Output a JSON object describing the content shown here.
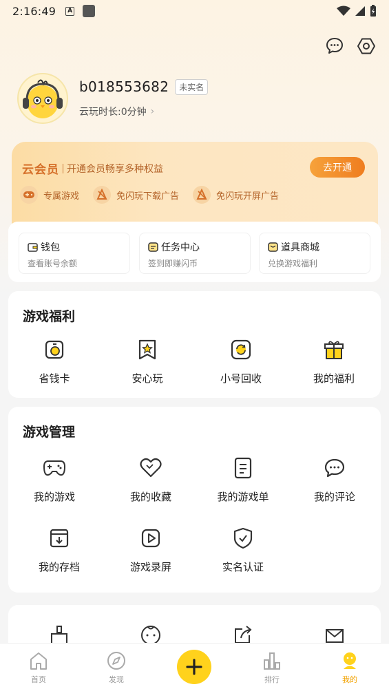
{
  "status_bar": {
    "time": "2:16:49",
    "a_glyph": "A"
  },
  "header": {
    "message_icon": "message-icon",
    "settings_icon": "settings-hex-icon"
  },
  "profile": {
    "username": "b018553682",
    "badge": "未实名",
    "playtime": "云玩时长:0分钟",
    "avatar_icon": "chick-headphones-avatar"
  },
  "vip": {
    "title": "云会员",
    "desc": "开通会员畅享多种权益",
    "button": "去开通",
    "perks": [
      {
        "label": "专属游戏",
        "icon": "gamepad-icon"
      },
      {
        "label": "免闪玩下载广告",
        "icon": "no-ad-icon"
      },
      {
        "label": "免闪玩开屏广告",
        "icon": "no-ad-icon"
      }
    ],
    "colors": {
      "accent": "#ef7d1f",
      "text": "#b4642a"
    }
  },
  "wallet": {
    "items": [
      {
        "title": "钱包",
        "sub": "查看账号余额"
      },
      {
        "title": "任务中心",
        "sub": "签到即赚闪币"
      },
      {
        "title": "道具商城",
        "sub": "兑换游戏福利"
      }
    ]
  },
  "benefits": {
    "title": "游戏福利",
    "items": [
      {
        "label": "省钱卡",
        "icon": "saving-card-icon"
      },
      {
        "label": "安心玩",
        "icon": "star-bookmark-icon"
      },
      {
        "label": "小号回收",
        "icon": "recycle-icon"
      },
      {
        "label": "我的福利",
        "icon": "gift-icon"
      }
    ]
  },
  "management": {
    "title": "游戏管理",
    "items": [
      {
        "label": "我的游戏",
        "icon": "gamepad-icon"
      },
      {
        "label": "我的收藏",
        "icon": "heart-icon"
      },
      {
        "label": "我的游戏单",
        "icon": "list-icon"
      },
      {
        "label": "我的评论",
        "icon": "comment-icon"
      },
      {
        "label": "我的存档",
        "icon": "archive-icon"
      },
      {
        "label": "游戏录屏",
        "icon": "play-icon"
      },
      {
        "label": "实名认证",
        "icon": "shield-check-icon"
      }
    ]
  },
  "more": {
    "icons": [
      "brush-icon",
      "baby-face-icon",
      "share-icon",
      "mail-icon"
    ]
  },
  "bottom_nav": {
    "items": [
      {
        "label": "首页",
        "icon": "home-icon"
      },
      {
        "label": "发现",
        "icon": "compass-icon"
      },
      {
        "label": "排行",
        "icon": "ranking-icon"
      },
      {
        "label": "我的",
        "icon": "me-icon",
        "active": true
      }
    ],
    "add_icon": "plus-icon",
    "active_color": "#f2a200"
  }
}
